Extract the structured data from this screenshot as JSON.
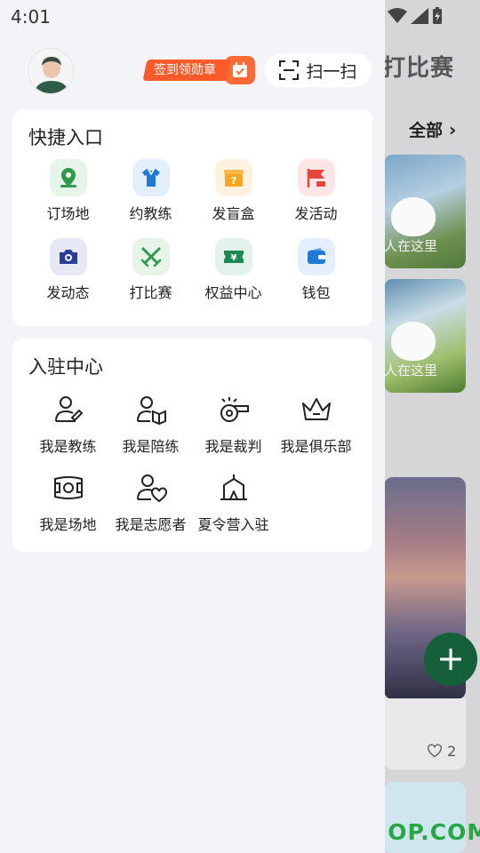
{
  "status_bar": {
    "time": "4:01"
  },
  "background": {
    "title": "打比赛",
    "all_link": "全部",
    "card_caption_1": "人在这里",
    "card_caption_2": "人在这里",
    "like_count": "2",
    "watermark": "ITMOP.COM"
  },
  "header": {
    "checkin_badge": "签到领勋章",
    "scan_label": "扫一扫"
  },
  "quick_entry": {
    "title": "快捷入口",
    "items": [
      {
        "label": "订场地",
        "icon": "location-pin-icon",
        "color": "#2e9a4a"
      },
      {
        "label": "约教练",
        "icon": "jersey-icon",
        "color": "#1f7ad6"
      },
      {
        "label": "发盲盒",
        "icon": "mystery-box-icon",
        "color": "#f5a623"
      },
      {
        "label": "发活动",
        "icon": "flag-icon",
        "color": "#e8453c"
      },
      {
        "label": "发动态",
        "icon": "camera-icon",
        "color": "#2c3c9c"
      },
      {
        "label": "打比赛",
        "icon": "crossed-swords-icon",
        "color": "#2e9a4a"
      },
      {
        "label": "权益中心",
        "icon": "ticket-icon",
        "color": "#1d8a56"
      },
      {
        "label": "钱包",
        "icon": "wallet-icon",
        "color": "#1f7ad6"
      }
    ]
  },
  "settle_center": {
    "title": "入驻中心",
    "items": [
      {
        "label": "我是教练",
        "icon": "coach-icon"
      },
      {
        "label": "我是陪练",
        "icon": "partner-icon"
      },
      {
        "label": "我是裁判",
        "icon": "whistle-icon"
      },
      {
        "label": "我是俱乐部",
        "icon": "crown-icon"
      },
      {
        "label": "我是场地",
        "icon": "field-icon"
      },
      {
        "label": "我是志愿者",
        "icon": "volunteer-icon"
      },
      {
        "label": "夏令营入驻",
        "icon": "tent-icon"
      }
    ]
  }
}
